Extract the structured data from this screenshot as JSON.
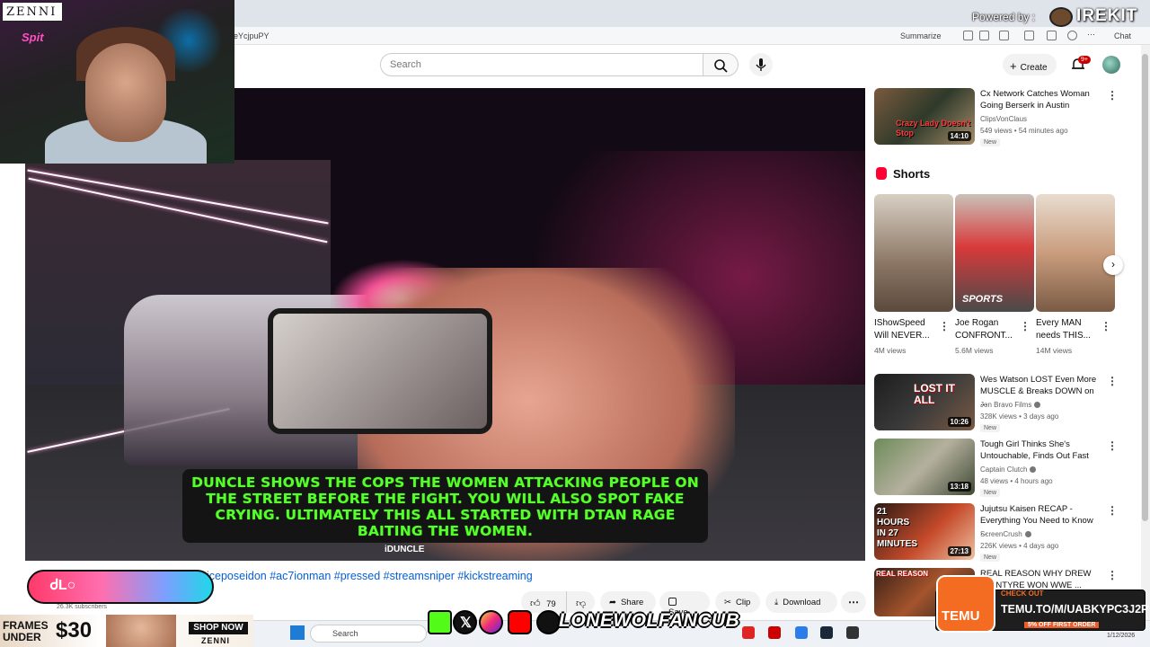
{
  "browser": {
    "url": "eYcjpuPY",
    "summarize_label": "Summarize",
    "chat_label": "Chat"
  },
  "header": {
    "search_placeholder": "Search",
    "create_label": "Create",
    "notification_count": "9+"
  },
  "overlay": {
    "powered_by": "Powered by :",
    "brand": "IREKIT",
    "zenni_logo": "ZENNI",
    "cam_sign": "Spit"
  },
  "video": {
    "caption": "DUNCLE SHOWS THE COPS THE WOMEN ATTACKING PEOPLE ON THE STREET BEFORE THE FIGHT. YOU WILL ALSO SPOT FAKE CRYING. ULTIMATELY THIS ALL STARTED WITH DTAN RAGE BAITING THE WOMEN.",
    "watermark": "iDUNCLE",
    "hashtags": "iceposeidon #ac7ionman #pressed #streamsniper #kickstreaming",
    "channel_pill": "ᏧL○",
    "subscribers": "26.3K subscribers",
    "like_count": "79",
    "actions": {
      "share": "Share",
      "save": "Save",
      "clip": "Clip",
      "download": "Download"
    }
  },
  "sidebar": {
    "top_video": {
      "title": "Cx Network Catches Woman Going Berserk in Austin",
      "channel": "ClipsVonClaus",
      "meta": "549 views • 54 minutes ago",
      "badge": "New",
      "duration": "14:10",
      "thumb_text": "Crazy Lady Doesn't Stop"
    },
    "shorts_heading": "Shorts",
    "shorts": [
      {
        "title": "IShowSpeed Will NEVER...",
        "views": "4M views"
      },
      {
        "title": "Joe Rogan CONFRONT...",
        "views": "5.6M views",
        "thumb_text": "SPORTS"
      },
      {
        "title": "Every MAN needs THIS...",
        "views": "14M views"
      }
    ],
    "videos": [
      {
        "title": "Wes Watson LOST Even More MUSCLE & Breaks DOWN on ...",
        "channel": "Jon Bravo Films",
        "meta": "328K views • 3 days ago",
        "badge": "New",
        "duration": "10:26",
        "thumb_text": "LOST IT ALL"
      },
      {
        "title": "Tough Girl Thinks She's Untouchable, Finds Out Fast",
        "channel": "Captain Clutch",
        "meta": "48 views • 4 hours ago",
        "badge": "New",
        "duration": "13:18"
      },
      {
        "title": "Jujutsu Kaisen RECAP - Everything You Need to Know ...",
        "channel": "ScreenCrush",
        "meta": "226K views • 4 days ago",
        "badge": "New",
        "duration": "27:13",
        "thumb_text": "21 HOURS IN 27 MINUTES"
      },
      {
        "title": "REAL REASON WHY DREW MCINTYRE WON WWE ...",
        "thumb_text": "REAL REASON"
      }
    ]
  },
  "ads": {
    "frames": "FRAMES UNDER",
    "frames_price": "$30",
    "shop_now": "SHOP NOW",
    "zenni_small": "ZENNI",
    "social_handle": "LONEWOLFANCUB",
    "temu_check": "CHECK OUT",
    "temu_url": "TEMU.TO/M/UABKYPC3J2P",
    "temu_off": "5% OFF FIRST ORDER",
    "temu_logo": "TEMU"
  },
  "taskbar": {
    "search": "Search",
    "date": "1/12/2026"
  }
}
